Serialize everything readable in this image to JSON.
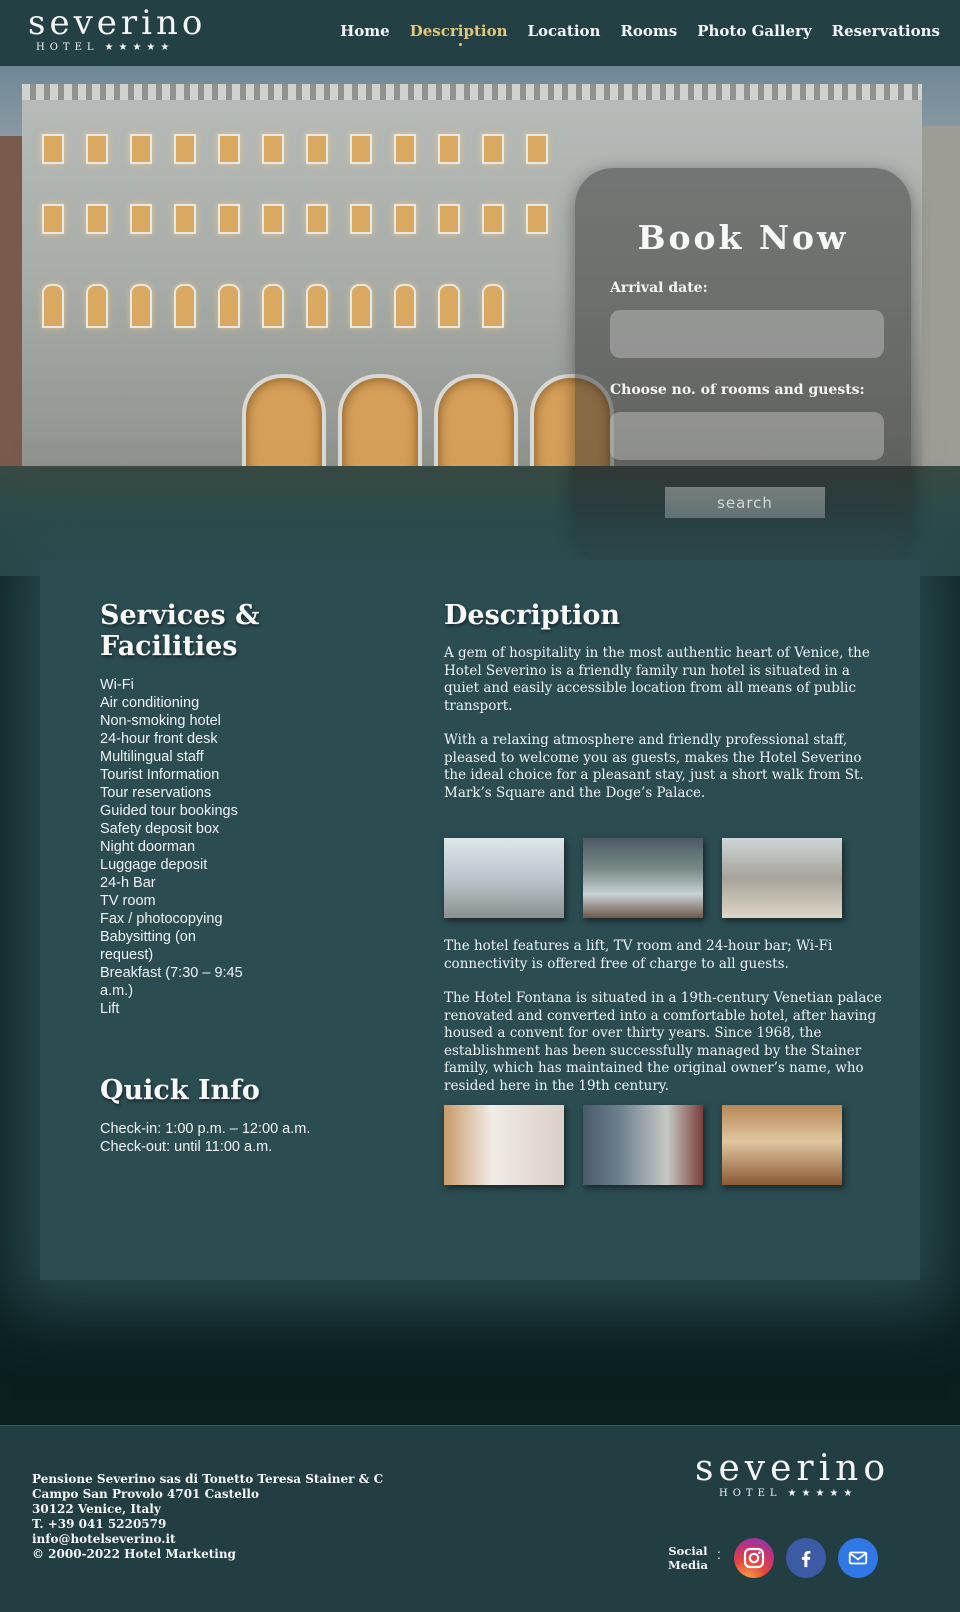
{
  "brand": {
    "name": "severino",
    "tagline": "HOTEL",
    "stars": "★★★★★"
  },
  "nav": {
    "items": [
      {
        "label": "Home"
      },
      {
        "label": "Description",
        "active": true
      },
      {
        "label": "Location"
      },
      {
        "label": "Rooms"
      },
      {
        "label": "Photo Gallery"
      },
      {
        "label": "Reservations"
      }
    ]
  },
  "booking": {
    "title": "Book Now",
    "arrival_label": "Arrival date:",
    "arrival_value": "",
    "rooms_label": "Choose no. of rooms and guests:",
    "rooms_value": "",
    "search_label": "search"
  },
  "services": {
    "title": "Services & Facilities",
    "items": [
      "Wi-Fi",
      "Air conditioning",
      "Non-smoking hotel",
      "24-hour front desk",
      "Multilingual staff",
      "Tourist Information",
      "Tour reservations",
      "Guided tour bookings",
      "Safety deposit box",
      "Night doorman",
      "Luggage deposit",
      "24-h Bar",
      "TV room",
      "Fax / photocopying",
      "Babysitting (on request)",
      "Breakfast (7:30 – 9:45 a.m.)",
      "Lift"
    ]
  },
  "quick_info": {
    "title": "Quick Info",
    "checkin": "Check-in: 1:00 p.m. – 12:00 a.m.",
    "checkout": "Check-out: until 11:00 a.m."
  },
  "description": {
    "title": "Description",
    "p1": "A gem of hospitality in the most authentic heart of Venice, the Hotel Severino is a friendly family run hotel is situated in a quiet and easily accessible location from all means of public transport.",
    "p2": "With a relaxing atmosphere and friendly professional staff, pleased to welcome you as guests, makes the Hotel Severino the ideal choice for a pleasant stay, just a short walk from St. Mark’s Square and the Doge’s Palace.",
    "p3": "The hotel features a lift, TV room and 24-hour bar; Wi-Fi connectivity is offered free of charge to all guests.",
    "p4": "The Hotel Fontana is situated in a 19th-century Venetian palace renovated and converted into a comfortable hotel, after having housed a convent for over thirty years. Since 1968, the establishment has been successfully managed by the Stainer family, which has maintained the original owner’s name, who resided here in the 19th century."
  },
  "footer": {
    "company": "Pensione Severino sas di Tonetto Teresa Stainer & C",
    "street": "Campo San Provolo 4701 Castello",
    "city": "30122 Venice, Italy",
    "phone": "T. +39 041 5220579",
    "email": "info@hotelseverino.it",
    "copyright": "© 2000-2022 Hotel Marketing",
    "social_label_1": "Social",
    "social_label_2": "Media",
    "colon": ":"
  },
  "colors": {
    "header_bg": "#234044",
    "accent": "#e3c67c",
    "panel_bg": "#2b4c51",
    "footer_bg": "#233e42"
  },
  "icons": [
    "instagram-icon",
    "facebook-icon",
    "email-icon"
  ]
}
